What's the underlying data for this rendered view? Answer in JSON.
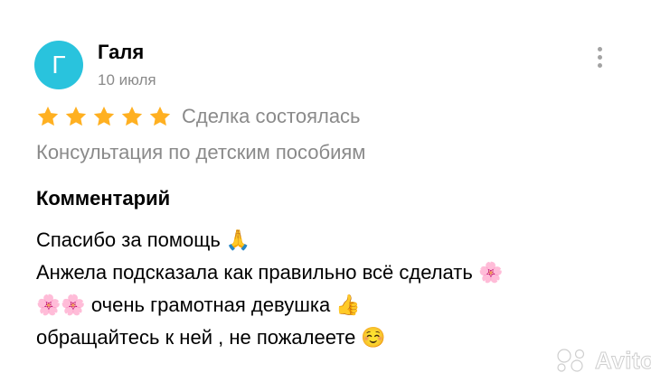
{
  "review": {
    "avatar_letter": "Г",
    "author_name": "Галя",
    "date": "10 июля",
    "rating": 5,
    "max_rating": 5,
    "deal_status": "Сделка состоялась",
    "item_title": "Консультация по детским пособиям",
    "comment_heading": "Комментарий",
    "comment_lines": [
      "Спасибо за помощь 🙏",
      "Анжела подсказала как правильно всё сделать 🌸",
      "🌸🌸 очень грамотная девушка 👍",
      "обращайтесь к ней , не пожалеете ☺️"
    ]
  },
  "watermark": {
    "brand": "Avito"
  },
  "colors": {
    "avatar_bg": "#29c3dd",
    "star": "#ffb021",
    "muted_text": "#8a8a8a",
    "menu_dots": "#a3a3a3"
  },
  "icons": {
    "menu": "vertical-dots-icon",
    "rating": "star-icon",
    "watermark_logo": "avito-dots-icon"
  }
}
